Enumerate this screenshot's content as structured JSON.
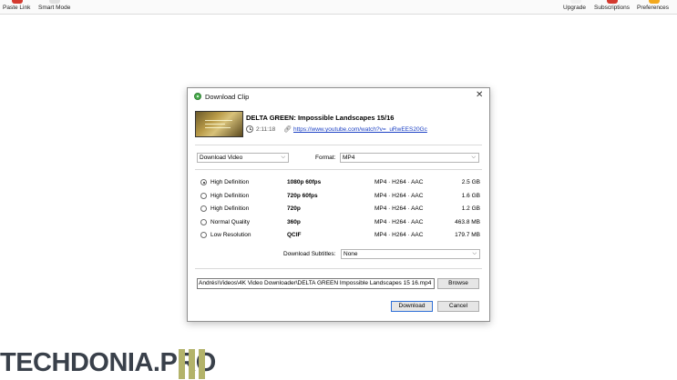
{
  "toolbar": {
    "left": [
      {
        "label": "Paste Link",
        "icon": "paste-link-icon",
        "color": "#d43a2f"
      },
      {
        "label": "Smart Mode",
        "icon": "smart-mode-icon",
        "color": "#e0e0e0"
      }
    ],
    "right": [
      {
        "label": "Upgrade",
        "icon": "upgrade-icon",
        "color": "#f0f0f0"
      },
      {
        "label": "Subscriptions",
        "icon": "subscriptions-icon",
        "color": "#d43a2f"
      },
      {
        "label": "Preferences",
        "icon": "preferences-icon",
        "color": "#f2a81d"
      }
    ]
  },
  "dialog": {
    "title": "Download Clip",
    "close_icon": "close-icon",
    "video": {
      "title": "DELTA GREEN: Impossible Landscapes 15/16",
      "duration": "2:11:18",
      "url": "https://www.youtube.com/watch?v=_uRwEES20Gc"
    },
    "download_type": {
      "value": "Download Video"
    },
    "format": {
      "label": "Format:",
      "value": "MP4"
    },
    "options": [
      {
        "quality": "High Definition",
        "resolution": "1080p 60fps",
        "format": "MP4 · H264 · AAC",
        "size": "2.5 GB",
        "selected": true
      },
      {
        "quality": "High Definition",
        "resolution": "720p 60fps",
        "format": "MP4 · H264 · AAC",
        "size": "1.6 GB",
        "selected": false
      },
      {
        "quality": "High Definition",
        "resolution": "720p",
        "format": "MP4 · H264 · AAC",
        "size": "1.2 GB",
        "selected": false
      },
      {
        "quality": "Normal Quality",
        "resolution": "360p",
        "format": "MP4 · H264 · AAC",
        "size": "463.8 MB",
        "selected": false
      },
      {
        "quality": "Low Resolution",
        "resolution": "QCIF",
        "format": "MP4 · H264 · AAC",
        "size": "179.7 MB",
        "selected": false
      }
    ],
    "subtitles": {
      "label": "Download Subtitles:",
      "value": "None"
    },
    "save_path": "Andrés\\Videos\\4K Video Downloader\\DELTA GREEN Impossible Landscapes 15 16.mp4",
    "buttons": {
      "browse": "Browse",
      "download": "Download",
      "cancel": "Cancel"
    },
    "accent_color": "#2f6fd6"
  },
  "watermark": {
    "text": "TECHDONIA.PRO"
  }
}
